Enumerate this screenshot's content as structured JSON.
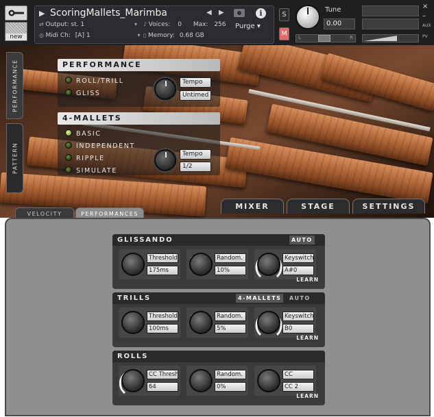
{
  "header": {
    "instrument_name": "ScoringMallets_Marimba",
    "output_label": "Output:",
    "output_value": "st. 1",
    "voices_label": "Voices:",
    "voices_value": "0",
    "max_label": "Max:",
    "max_value": "256",
    "midi_label": "Midi Ch:",
    "midi_value": "[A]  1",
    "memory_label": "Memory:",
    "memory_value": "0.68 GB",
    "purge_label": "Purge",
    "new_label": "new",
    "solo_label": "S",
    "mute_label": "M",
    "tune_label": "Tune",
    "tune_value": "0.00",
    "pan_left": "L",
    "pan_right": "R",
    "side_aux": "AUX",
    "side_pv": "PV"
  },
  "side_tabs": [
    "PERFORMANCE",
    "PATTERN"
  ],
  "performance": {
    "title": "PERFORMANCE",
    "options": [
      {
        "label": "ROLL/TRILL",
        "on": false
      },
      {
        "label": "GLISS",
        "on": false
      }
    ],
    "display_top": "Tempo",
    "display_bottom": "Untimed"
  },
  "mallets": {
    "title": "4-MALLETS",
    "options": [
      {
        "label": "BASIC",
        "on": true
      },
      {
        "label": "INDEPENDENT",
        "on": false
      },
      {
        "label": "RIPPLE",
        "on": false
      },
      {
        "label": "SIMULATE",
        "on": false
      }
    ],
    "display_top": "Tempo",
    "display_bottom": "1/2"
  },
  "tabs": {
    "small": [
      "VELOCITY",
      "PERFORMANCES"
    ],
    "big": [
      "MIXER",
      "STAGE",
      "SETTINGS"
    ]
  },
  "sections": [
    {
      "title": "GLISSANDO",
      "tags": [
        "AUTO"
      ],
      "controls": [
        {
          "top": "Threshold",
          "bottom": "175ms"
        },
        {
          "top": "Random.",
          "bottom": "10%"
        },
        {
          "top": "Keyswitch",
          "bottom": "A#0"
        }
      ],
      "learn": "LEARN"
    },
    {
      "title": "TRILLS",
      "tags": [
        "4-MALLETS",
        "AUTO"
      ],
      "controls": [
        {
          "top": "Threshold",
          "bottom": "100ms"
        },
        {
          "top": "Random.",
          "bottom": "5%"
        },
        {
          "top": "Keyswitch",
          "bottom": "B0"
        }
      ],
      "learn": "LEARN"
    },
    {
      "title": "ROLLS",
      "tags": [],
      "controls": [
        {
          "top": "CC Thresh",
          "bottom": "64"
        },
        {
          "top": "Random.",
          "bottom": "0%"
        },
        {
          "top": "CC",
          "bottom": "CC 2"
        }
      ],
      "learn": "LEARN"
    }
  ],
  "colors": {
    "panel_gray": "#8f8f91",
    "section_dark": "#3c3c3e",
    "led_on": "#a6c84a",
    "header_dark": "#1f1f21"
  }
}
